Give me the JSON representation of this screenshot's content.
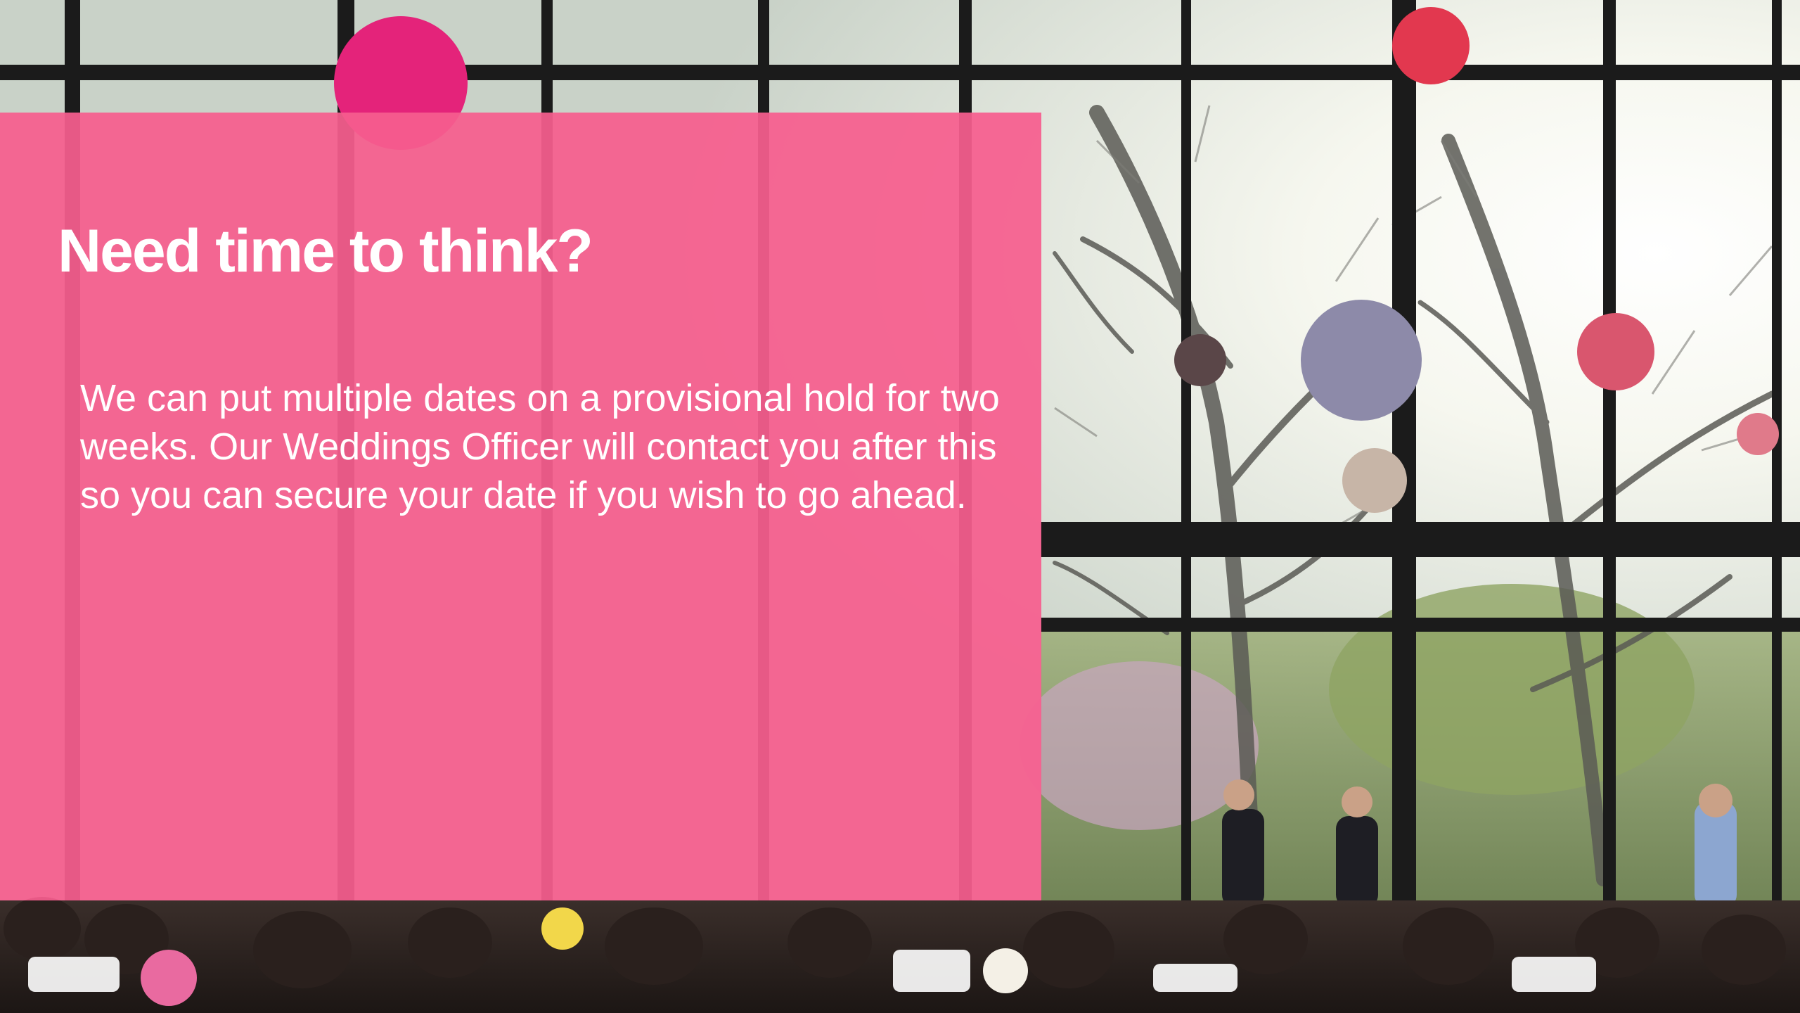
{
  "slide": {
    "heading": "Need time to think?",
    "body": "We can put multiple dates on a provisional hold for two weeks. Our Weddings Officer will contact you after this so you can secure your date if you wish to go ahead."
  },
  "colors": {
    "panel": "#f65e8e",
    "text": "#ffffff",
    "window_frame": "#1b1b1b",
    "sky": "#eef3f1"
  },
  "photo": {
    "subject": "wedding reception hall with large windows, paper pom-poms, trees and seated guests"
  }
}
